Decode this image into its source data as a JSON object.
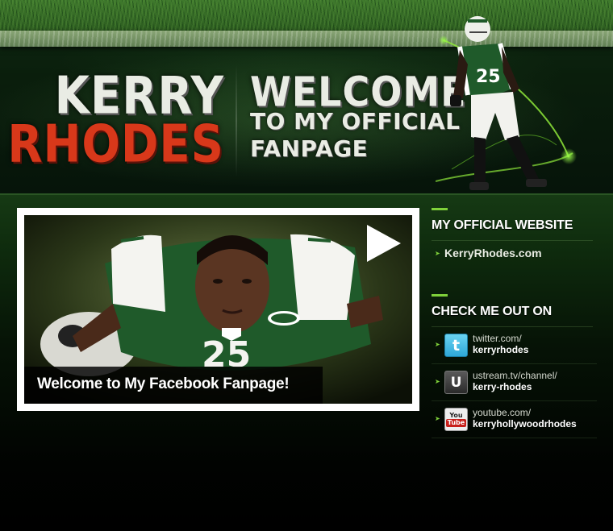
{
  "header": {
    "name_first": "KERRY",
    "name_last": "RHODES",
    "welcome_line1": "WELCOME",
    "welcome_line2": "TO MY OFFICIAL",
    "welcome_line3": "FANPAGE",
    "jersey_number": "25"
  },
  "video": {
    "caption": "Welcome to My Facebook Fanpage!",
    "play_icon": "play-icon"
  },
  "sidebar": {
    "website_heading": "MY OFFICIAL WEBSITE",
    "website_link": "KerryRhodes.com",
    "social_heading": "CHECK ME OUT ON",
    "social": [
      {
        "icon": "twitter-icon",
        "line1": "twitter.com/",
        "line2": "kerryrhodes"
      },
      {
        "icon": "ustream-icon",
        "line1": "ustream.tv/channel/",
        "line2": "kerry-rhodes"
      },
      {
        "icon": "youtube-icon",
        "line1": "youtube.com/",
        "line2": "kerryhollywoodrhodes"
      }
    ],
    "youtube_logo_you": "You",
    "youtube_logo_tube": "Tube",
    "ustream_logo": "U",
    "twitter_logo": "t"
  },
  "colors": {
    "accent_green": "#7fd13a",
    "name_red": "#d8381a",
    "jersey_green": "#1f5a2a"
  }
}
